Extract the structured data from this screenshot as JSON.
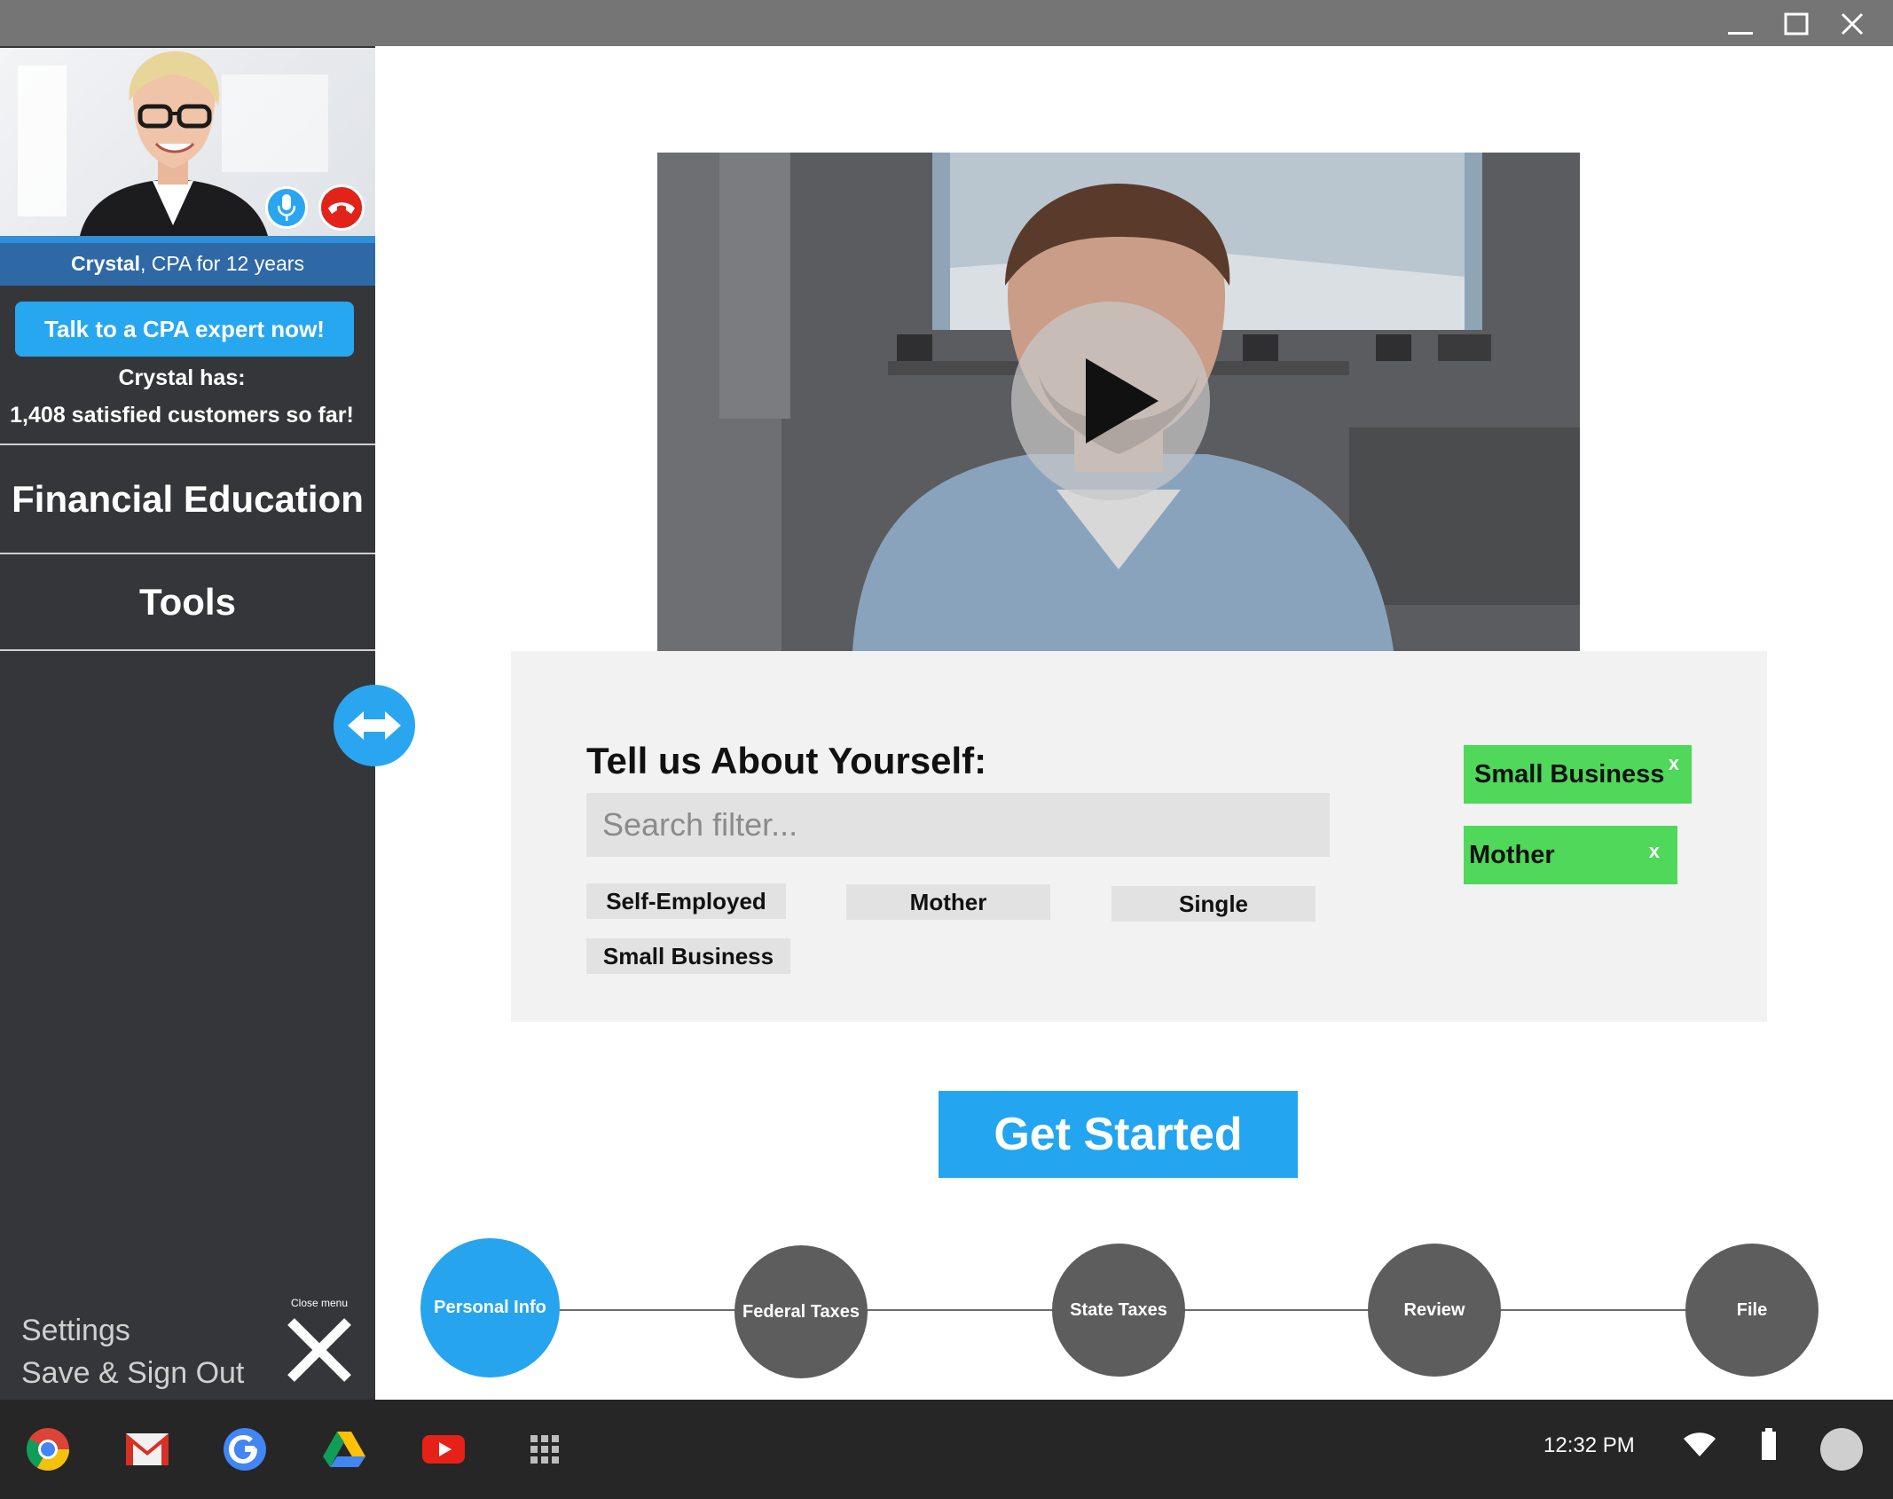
{
  "window": {
    "buttons": [
      "minimize",
      "maximize",
      "close"
    ]
  },
  "sidebar": {
    "agent": {
      "name": "Crystal",
      "credential": ", CPA for 12 years"
    },
    "talk_button": "Talk to a CPA expert now!",
    "has_line": "Crystal has:",
    "customers_line": "1,408 satisfied customers so far!",
    "nav": [
      "Financial Education",
      "Tools"
    ],
    "settings": "Settings",
    "save_sign_out": "Save & Sign Out",
    "close_menu": "Close menu"
  },
  "about": {
    "title": "Tell us About Yourself:",
    "search_placeholder": "Search filter...",
    "chips": [
      "Self-Employed",
      "Mother",
      "Single",
      "Small Business"
    ],
    "selected": [
      "Small Business",
      "Mother"
    ],
    "remove_glyph": "x"
  },
  "cta": "Get Started",
  "steps": [
    "Personal Info",
    "Federal Taxes",
    "State Taxes",
    "Review",
    "File"
  ],
  "active_step": "Personal Info",
  "taskbar": {
    "apps": [
      "chrome-icon",
      "gmail-icon",
      "google-icon",
      "drive-icon",
      "youtube-icon",
      "launcher-icon"
    ],
    "clock": "12:32 PM"
  },
  "colors": {
    "accent": "#26a5ee",
    "selected_tag": "#4fd85a",
    "sidebar": "#353639",
    "hangup": "#e2231a"
  }
}
